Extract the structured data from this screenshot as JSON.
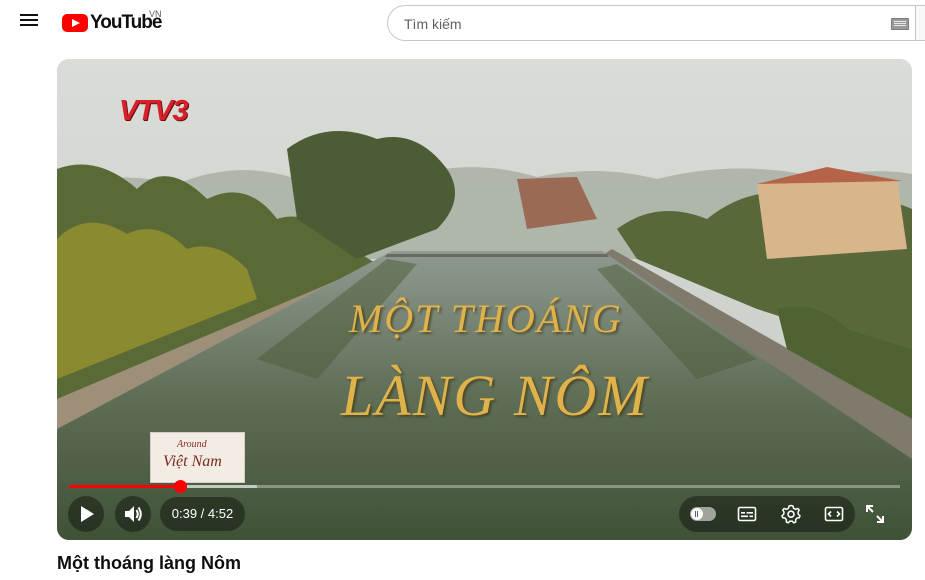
{
  "header": {
    "logo_text": "YouTube",
    "country_code": "VN",
    "search_placeholder": "Tìm kiếm"
  },
  "player": {
    "channel_logo": "VTV3",
    "overlay_title_line1": "MỘT THOÁNG",
    "overlay_title_line2": "LÀNG NÔM",
    "stamp_top": "Around",
    "stamp_bottom": "Việt Nam",
    "time_display": "0:39 / 4:52",
    "current_time": "0:39",
    "duration": "4:52",
    "progress_fraction": 0.134,
    "buffer_fraction": 0.226,
    "accent_color": "#ff0000"
  },
  "icons": [
    "menu-icon",
    "youtube-logo-icon",
    "keyboard-icon",
    "play-icon",
    "volume-icon",
    "autoplay-toggle-icon",
    "subtitles-icon",
    "settings-icon",
    "miniplayer-icon",
    "fullscreen-icon"
  ],
  "video": {
    "title": "Một thoáng làng Nôm"
  }
}
